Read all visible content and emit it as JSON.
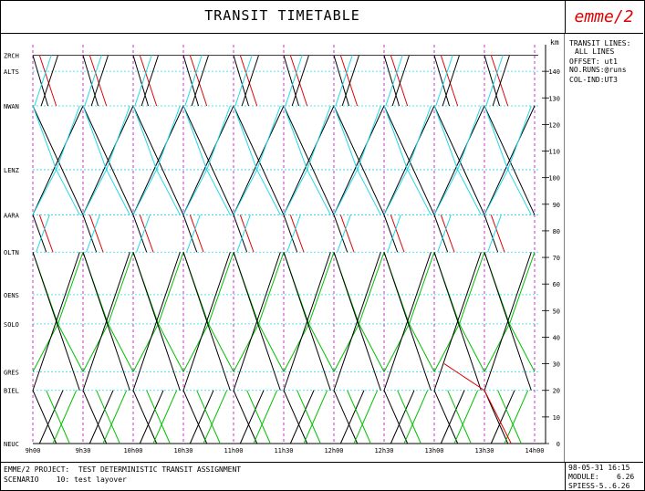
{
  "title": "TRANSIT TIMETABLE",
  "logo_text": "emme/2",
  "side_panel": {
    "line1": "TRANSIT LINES:",
    "line2": "ALL LINES",
    "line3": "OFFSET: ut1",
    "line4": "NO.RUNS:@runs",
    "line5": "COL-IND:UT3"
  },
  "footer": {
    "project": "EMME/2 PROJECT:  TEST DETERMINISTIC TRANSIT ASSIGNMENT",
    "scenario": "SCENARIO    10: test layover",
    "date": "98-05-31 16:15",
    "module": "MODULE:    6.26",
    "version": "SPIESS-5..6.26"
  },
  "colors": {
    "red": "#e00000",
    "cyan": "#20d8e8",
    "green": "#00c000",
    "black": "#000000",
    "magenta": "#c000c0"
  },
  "chart_data": {
    "type": "line",
    "title": "TRANSIT TIMETABLE",
    "xlabel": "",
    "ylabel": "km",
    "xlim": [
      "9h00",
      "14h00"
    ],
    "ylim": [
      0,
      150
    ],
    "x_ticks": [
      "9h00",
      "9h30",
      "10h00",
      "10h30",
      "11h00",
      "11h30",
      "12h00",
      "12h30",
      "13h00",
      "13h30",
      "14h00"
    ],
    "y_ticks": [
      0,
      10,
      20,
      30,
      40,
      50,
      60,
      70,
      80,
      90,
      100,
      110,
      120,
      130,
      140
    ],
    "stations": [
      {
        "name": "ZRCH",
        "km": 146
      },
      {
        "name": "ALTS",
        "km": 140
      },
      {
        "name": "NWAN",
        "km": 127
      },
      {
        "name": "LENZ",
        "km": 103
      },
      {
        "name": "AARA",
        "km": 86
      },
      {
        "name": "OLTN",
        "km": 72
      },
      {
        "name": "OENS",
        "km": 56
      },
      {
        "name": "SOLO",
        "km": 45
      },
      {
        "name": "GRES",
        "km": 27
      },
      {
        "name": "BIEL",
        "km": 20
      },
      {
        "name": "NEUC",
        "km": 0
      }
    ],
    "series": [
      {
        "color": "black",
        "trips": [
          [
            "9h00",
            146,
            "9h30",
            127
          ]
        ]
      },
      {
        "color": "cyan",
        "trips": [
          [
            "9h00",
            127,
            "9h30",
            146
          ]
        ]
      },
      {
        "color": "red",
        "trips": [
          [
            "9h00",
            146,
            "9h30",
            127
          ]
        ]
      },
      {
        "color": "green",
        "trips": [
          [
            "9h00",
            72,
            "9h30",
            45
          ]
        ]
      }
    ]
  }
}
